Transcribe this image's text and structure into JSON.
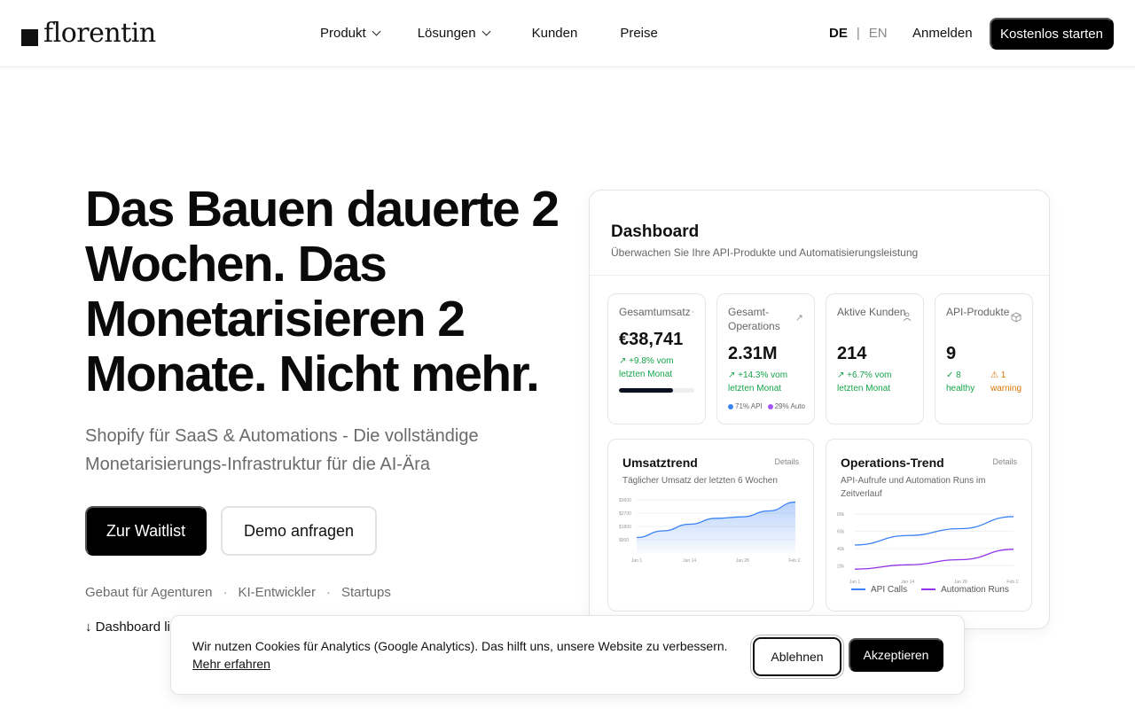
{
  "nav": {
    "logo": "florentin",
    "links": [
      {
        "label": "Produkt",
        "dropdown": true
      },
      {
        "label": "Lösungen",
        "dropdown": true
      },
      {
        "label": "Kunden",
        "dropdown": false
      },
      {
        "label": "Preise",
        "dropdown": false
      }
    ],
    "lang_active": "DE",
    "lang_separator": "|",
    "lang_other": "EN",
    "login": "Anmelden",
    "cta": "Kostenlos starten"
  },
  "hero": {
    "title": "Das Bauen dauerte 2 Wochen. Das Monetarisieren 2 Monate. Nicht mehr.",
    "subtitle": "Shopify für SaaS & Automations - Die vollständige Monetarisierungs-Infrastruktur für die AI-Ära",
    "primary_button": "Zur Waitlist",
    "secondary_button": "Demo anfragen",
    "audience": [
      "Gebaut für Agenturen",
      "KI-Entwickler",
      "Startups"
    ],
    "audience_separator": "·",
    "live_link": "↓ Dashboard live"
  },
  "dashboard": {
    "title": "Dashboard",
    "subtitle": "Überwachen Sie Ihre API-Produkte und Automatisierungsleistung",
    "kpis": [
      {
        "label": "Gesamtumsatz",
        "value": "€38,741",
        "trend": "↗ +9.8% vom letzten Monat",
        "icon": "euro-icon",
        "progress": 0.72
      },
      {
        "label": "Gesamt-Operations",
        "value": "2.31M",
        "trend": "↗ +14.3% vom letzten Monat",
        "icon": "trend-arrow-icon",
        "split_api": "71% API",
        "split_auto": "29% Auto"
      },
      {
        "label": "Aktive Kunden",
        "value": "214",
        "trend": "↗ +6.7% vom letzten Monat",
        "icon": "users-icon"
      },
      {
        "label": "API-Produkte",
        "value": "9",
        "healthy": "✓ 8 healthy",
        "warning": "⚠ 1 warning",
        "icon": "box-icon"
      }
    ],
    "details_label": "Details"
  },
  "colors": {
    "brand": "#000000",
    "positive": "#16a34a",
    "warning": "#d97706",
    "api_series": "#3b82f6",
    "automation_series": "#9333ea"
  },
  "chart_data": [
    {
      "type": "area",
      "title": "Umsatztrend",
      "subtitle": "Täglicher Umsatz der letzten 6 Wochen",
      "x_ticks": [
        "Jan 1",
        "Jan 14",
        "Jan 28",
        "Feb 11"
      ],
      "y_ticks": [
        "$900",
        "$1800",
        "$2700",
        "$3600"
      ],
      "ylim": [
        0,
        3600
      ],
      "x": [
        "Jan 1",
        "Jan 7",
        "Jan 14",
        "Jan 21",
        "Jan 28",
        "Feb 4",
        "Feb 11"
      ],
      "series": [
        {
          "values": [
            1050,
            1500,
            1950,
            2350,
            2450,
            2850,
            3450
          ]
        }
      ]
    },
    {
      "type": "line",
      "title": "Operations-Trend",
      "subtitle": "API-Aufrufe und Automation Runs im Zeitverlauf",
      "x_ticks": [
        "Jan 1",
        "Jan 14",
        "Jan 28",
        "Feb 11"
      ],
      "y_ticks": [
        "20k",
        "40k",
        "60k",
        "80k"
      ],
      "ylim": [
        10000,
        80000
      ],
      "x": [
        "Jan 1",
        "Jan 14",
        "Jan 28",
        "Feb 11"
      ],
      "series": [
        {
          "name": "API Calls",
          "values": [
            44000,
            55000,
            63000,
            77000
          ]
        },
        {
          "name": "Automation Runs",
          "values": [
            16000,
            21000,
            27000,
            39000
          ]
        }
      ]
    }
  ],
  "cookie": {
    "text": "Wir nutzen Cookies für Analytics (Google Analytics). Das hilft uns, unsere Website zu verbessern.",
    "link": "Mehr erfahren",
    "decline": "Ablehnen",
    "accept": "Akzeptieren"
  }
}
